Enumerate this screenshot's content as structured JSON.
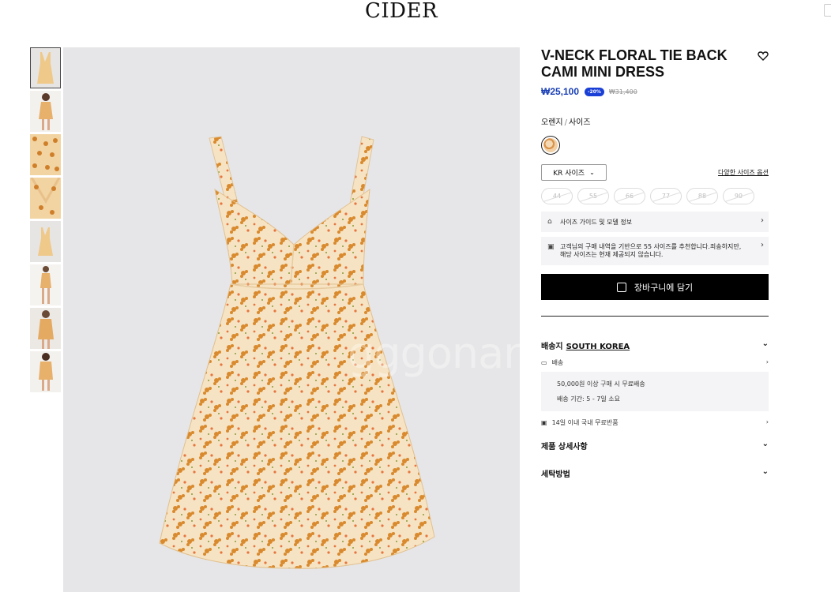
{
  "header": {
    "logo": "CIDER"
  },
  "gallery": {
    "thumbnail_count": 8,
    "selected_index": 0,
    "watermark": "gggonara"
  },
  "product": {
    "title": "V-NECK FLORAL TIE BACK CAMI MINI DRESS",
    "price": "₩25,100",
    "discount": "-20%",
    "original_price": "₩31,400",
    "color_label": "오렌지",
    "size_label": "사이즈",
    "size_system": "KR 사이즈",
    "size_options_link": "다양한 사이즈 옵션",
    "sizes": [
      "44",
      "55",
      "66",
      "77",
      "88",
      "99"
    ],
    "size_guide": "사이즈 가이드 및 모델 정보",
    "recommendation": "고객님의 구매 내역을 기반으로 55 사이즈를 추천합니다.죄송하지만, 해당 사이즈는 현재 제공되지 않습니다.",
    "add_to_cart": "장바구니에 담기"
  },
  "shipping": {
    "label": "배송지",
    "country": "SOUTH KOREA",
    "delivery_label": "배송",
    "free_shipping": "50,000원 이상 구매 시 무료배송",
    "delivery_time": "배송 기간: 5 - 7일 소요",
    "returns": "14일 이내 국내 무료반품"
  },
  "sections": {
    "details": "제품 상세사항",
    "care": "세탁방법"
  },
  "colors": {
    "price_blue": "#1a3fb5",
    "button_black": "#000000",
    "image_bg": "#e6e6e8"
  }
}
